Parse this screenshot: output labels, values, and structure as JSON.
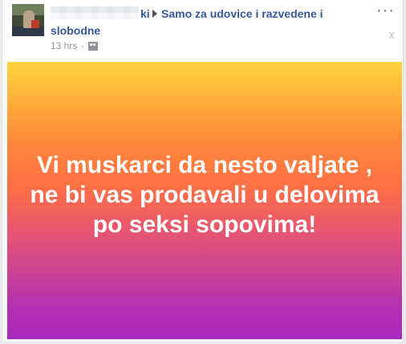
{
  "post": {
    "author_tail": "ki",
    "group_name_line1": "Samo za udovice i razvedene i",
    "group_name_line2": "slobodne",
    "timestamp": "13 hrs",
    "separator": "·",
    "menu_glyph": "···",
    "close_glyph": "x",
    "status_text": "Vi muskarci da nesto valjate ,\nne bi vas prodavali u delovima\npo seksi sopovima!",
    "icons": {
      "audience": "audience-icon",
      "arrow": "triangle-right-icon",
      "menu": "more-options-icon",
      "close": "close-icon"
    },
    "colors": {
      "link": "#365899",
      "meta": "#90949c",
      "gradient_top": "#ffd53b",
      "gradient_mid": "#ff6f44",
      "gradient_bottom": "#a928bf"
    }
  }
}
